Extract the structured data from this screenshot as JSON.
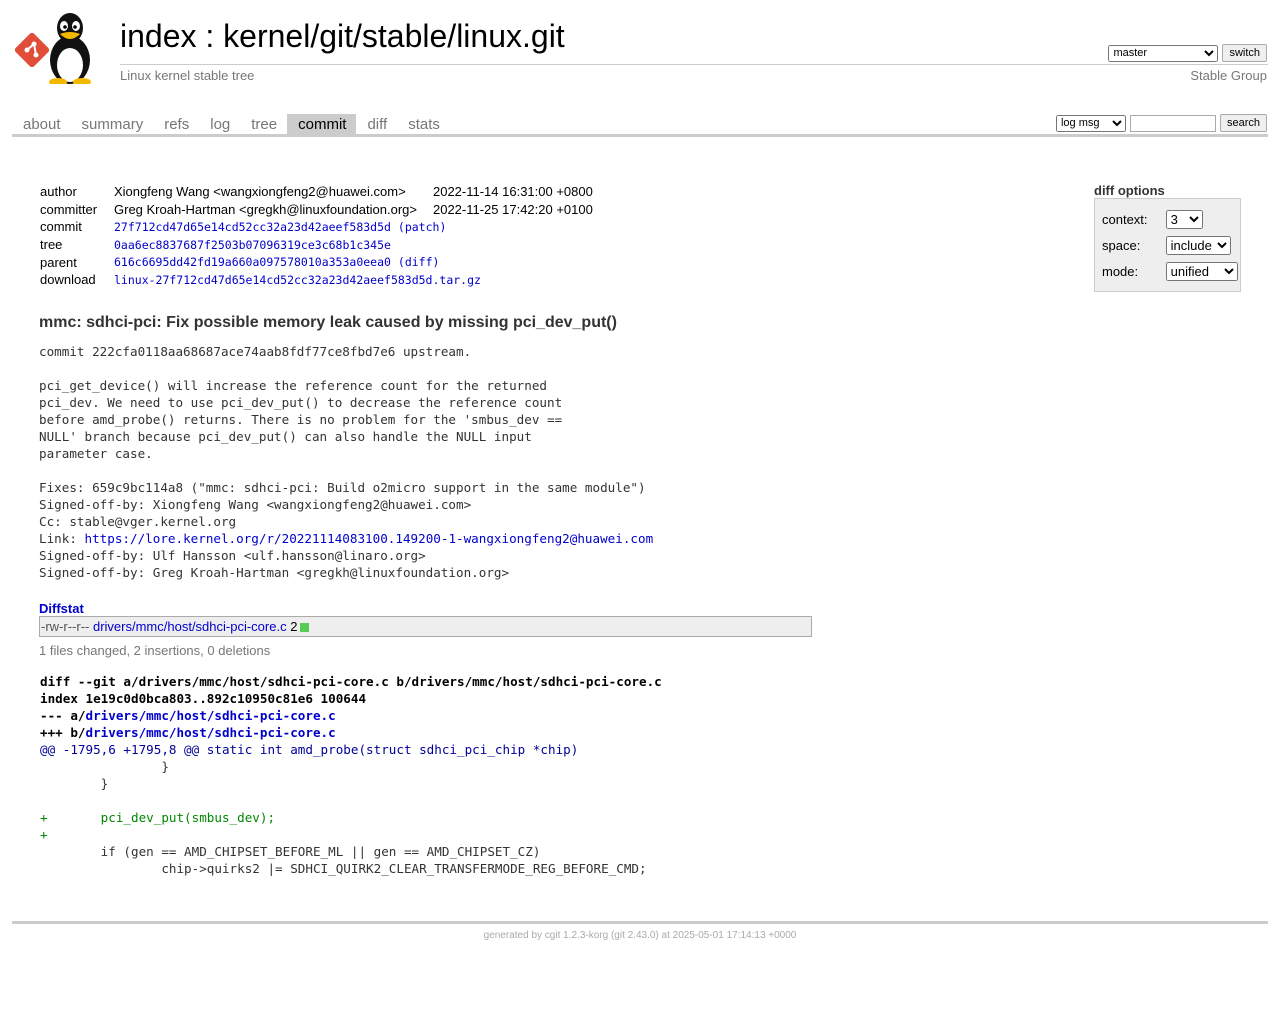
{
  "header": {
    "title_index": "index",
    "title_sep": " : ",
    "title_repo": "kernel/git/stable/linux.git",
    "subtitle": "Linux kernel stable tree",
    "owner": "Stable Group",
    "branch_selected": "master",
    "switch_label": "switch"
  },
  "tabs": [
    "about",
    "summary",
    "refs",
    "log",
    "tree",
    "commit",
    "diff",
    "stats"
  ],
  "active_tab": "commit",
  "search": {
    "type_selected": "log msg",
    "query": "",
    "button_label": "search"
  },
  "commit_info": {
    "author_label": "author",
    "author": "Xiongfeng Wang <wangxiongfeng2@huawei.com>",
    "author_date": "2022-11-14 16:31:00 +0800",
    "committer_label": "committer",
    "committer": "Greg Kroah-Hartman <gregkh@linuxfoundation.org>",
    "committer_date": "2022-11-25 17:42:20 +0100",
    "commit_label": "commit",
    "commit": "27f712cd47d65e14cd52cc32a23d42aeef583d5d",
    "patch_label": "patch",
    "tree_label": "tree",
    "tree": "0aa6ec8837687f2503b07096319ce3c68b1c345e",
    "parent_label": "parent",
    "parent": "616c6695dd42fd19a660a097578010a353a0eea0",
    "diff_label": "diff",
    "download_label": "download",
    "download": "linux-27f712cd47d65e14cd52cc32a23d42aeef583d5d.tar.gz"
  },
  "diff_options": {
    "title": "diff options",
    "context_label": "context:",
    "context_value": "3",
    "space_label": "space:",
    "space_value": "include",
    "mode_label": "mode:",
    "mode_value": "unified"
  },
  "subject": "mmc: sdhci-pci: Fix possible memory leak caused by missing pci_dev_put()",
  "message": {
    "body": "commit 222cfa0118aa68687ace74aab8fdf77ce8fbd7e6 upstream.\n\npci_get_device() will increase the reference count for the returned\npci_dev. We need to use pci_dev_put() to decrease the reference count\nbefore amd_probe() returns. There is no problem for the 'smbus_dev ==\nNULL' branch because pci_dev_put() can also handle the NULL input\nparameter case.\n\nFixes: 659c9bc114a8 (\"mmc: sdhci-pci: Build o2micro support in the same module\")\nSigned-off-by: Xiongfeng Wang <wangxiongfeng2@huawei.com>\nCc: stable@vger.kernel.org\n",
    "link_prefix": "Link: ",
    "link_url": "https://lore.kernel.org/r/20221114083100.149200-1-wangxiongfeng2@huawei.com",
    "tail": "\nSigned-off-by: Ulf Hansson <ulf.hansson@linaro.org>\nSigned-off-by: Greg Kroah-Hartman <gregkh@linuxfoundation.org>"
  },
  "diffstat": {
    "heading": "Diffstat",
    "mode": "-rw-r--r--",
    "file": "drivers/mmc/host/sdhci-pci-core.c",
    "changes": "2",
    "summary": "1 files changed, 2 insertions, 0 deletions",
    "graph_color": "#55cc55"
  },
  "diff": {
    "line1": "diff --git a/drivers/mmc/host/sdhci-pci-core.c b/drivers/mmc/host/sdhci-pci-core.c",
    "line2": "index 1e19c0d0bca803..892c10950c81e6 100644",
    "minus_prefix": "--- a/",
    "plus_prefix": "+++ b/",
    "file": "drivers/mmc/host/sdhci-pci-core.c",
    "hunk": "@@ -1795,6 +1795,8 @@ static int amd_probe(struct sdhci_pci_chip *chip)",
    "ctx1": "                }",
    "ctx2": "        }",
    "ctx3": "",
    "add1": "+       pci_dev_put(smbus_dev);",
    "add2": "+",
    "ctx4": "        if (gen == AMD_CHIPSET_BEFORE_ML || gen == AMD_CHIPSET_CZ)",
    "ctx5": "                chip->quirks2 |= SDHCI_QUIRK2_CLEAR_TRANSFERMODE_REG_BEFORE_CMD;"
  },
  "footer": {
    "prefix": "generated by ",
    "cgit": "cgit 1.2.3-korg",
    "rest": " (git 2.43.0) at 2025-05-01 17:14:13 +0000"
  },
  "colors": {
    "link": "#0000cc",
    "active_tab_bg": "#cccccc",
    "diff_add": "#008800",
    "diff_hunk": "#000099"
  }
}
